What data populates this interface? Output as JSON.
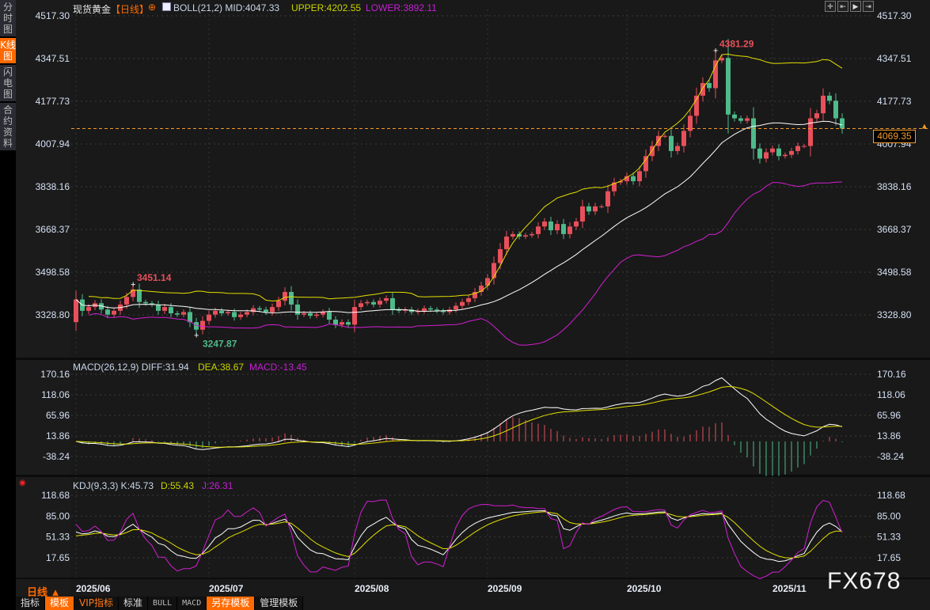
{
  "sidebar": {
    "tabs": [
      {
        "label": "分时图",
        "active": false
      },
      {
        "label": "K线图",
        "active": true
      },
      {
        "label": "闪电图",
        "active": false
      },
      {
        "label": "合约资料",
        "active": false
      }
    ]
  },
  "header": {
    "symbol": "现货黄金",
    "period": "【日线】",
    "boll": "BOLL(21,2) MID:4047.33",
    "upper": "UPPER:4202.55",
    "lower": "LOWER:3892.11"
  },
  "macd_header": {
    "name": "MACD(26,12,9) DIFF:31.94",
    "dea": "DEA:38.67",
    "macd": "MACD:-13.45"
  },
  "kdj_header": {
    "name": "KDJ(9,3,3) K:45.73",
    "d": "D:55.43",
    "j": "J:26.31"
  },
  "period_label": "日线 ▲",
  "toolbar_icons": [
    "crosshair-icon",
    "scroll-left-icon",
    "play-icon",
    "scroll-right-icon"
  ],
  "bottom_tabs": [
    {
      "label": "指标",
      "style": ""
    },
    {
      "label": "模板",
      "style": "or"
    },
    {
      "label": "VIP指标",
      "style": "vip"
    },
    {
      "label": "标准",
      "style": ""
    },
    {
      "label": "BULL",
      "style": "mono"
    },
    {
      "label": "MACD",
      "style": "mono"
    },
    {
      "label": "另存模板",
      "style": "or"
    },
    {
      "label": "管理模板",
      "style": ""
    }
  ],
  "watermark": "FX678",
  "current_price": "4069.35",
  "colors": {
    "up": "#e8505b",
    "down": "#4fba8a",
    "mid": "#ffffff",
    "upper": "#e3e000",
    "lower": "#d21fd2",
    "accent": "#ff6a00"
  },
  "chart_data": [
    {
      "type": "candlestick",
      "x_ticks": [
        "2025/06",
        "2025/07",
        "2025/08",
        "2025/09",
        "2025/10",
        "2025/11"
      ],
      "x_tick_index": [
        0,
        21,
        44,
        65,
        87,
        110
      ],
      "y_ticks": [
        "4517.30",
        "4347.51",
        "4177.73",
        "4007.94",
        "3838.16",
        "3668.37",
        "3498.58",
        "3328.80"
      ],
      "ylim": [
        3328.8,
        4517.3
      ],
      "close": [
        3390,
        3345,
        3360,
        3375,
        3350,
        3330,
        3345,
        3370,
        3400,
        3430,
        3380,
        3375,
        3370,
        3345,
        3360,
        3335,
        3330,
        3340,
        3300,
        3270,
        3305,
        3330,
        3345,
        3335,
        3340,
        3320,
        3330,
        3340,
        3355,
        3350,
        3340,
        3360,
        3385,
        3420,
        3370,
        3330,
        3335,
        3325,
        3330,
        3340,
        3310,
        3290,
        3300,
        3290,
        3360,
        3375,
        3380,
        3370,
        3385,
        3395,
        3350,
        3345,
        3350,
        3340,
        3345,
        3355,
        3350,
        3345,
        3340,
        3350,
        3365,
        3380,
        3395,
        3420,
        3445,
        3475,
        3535,
        3590,
        3640,
        3650,
        3640,
        3645,
        3650,
        3680,
        3700,
        3665,
        3690,
        3650,
        3680,
        3700,
        3760,
        3740,
        3760,
        3760,
        3820,
        3855,
        3860,
        3880,
        3860,
        3900,
        3960,
        4000,
        4040,
        4040,
        3980,
        4000,
        4060,
        4120,
        4200,
        4250,
        4230,
        4340,
        4350,
        4125,
        4110,
        4100,
        4110,
        3990,
        3950,
        3975,
        3990,
        3960,
        3965,
        3980,
        4000,
        4000,
        4110,
        4130,
        4200,
        4180,
        4110,
        4069.35
      ],
      "annotations": [
        {
          "text": "3451.14",
          "value": 3451.14,
          "index": 9,
          "kind": "high"
        },
        {
          "text": "3247.87",
          "value": 3247.87,
          "index": 19,
          "kind": "low"
        },
        {
          "text": "4381.29",
          "value": 4381.29,
          "index": 101,
          "kind": "high"
        }
      ],
      "indicator": "BOLL(21,2)",
      "grid": true
    },
    {
      "type": "line+bar",
      "y_ticks": [
        "170.16",
        "118.06",
        "65.96",
        "13.86",
        "-38.24"
      ],
      "ylim": [
        -38.24,
        170.16
      ]
    },
    {
      "type": "line",
      "y_ticks": [
        "118.68",
        "85.00",
        "51.33",
        "17.65"
      ],
      "ylim": [
        17.65,
        118.68
      ]
    }
  ]
}
